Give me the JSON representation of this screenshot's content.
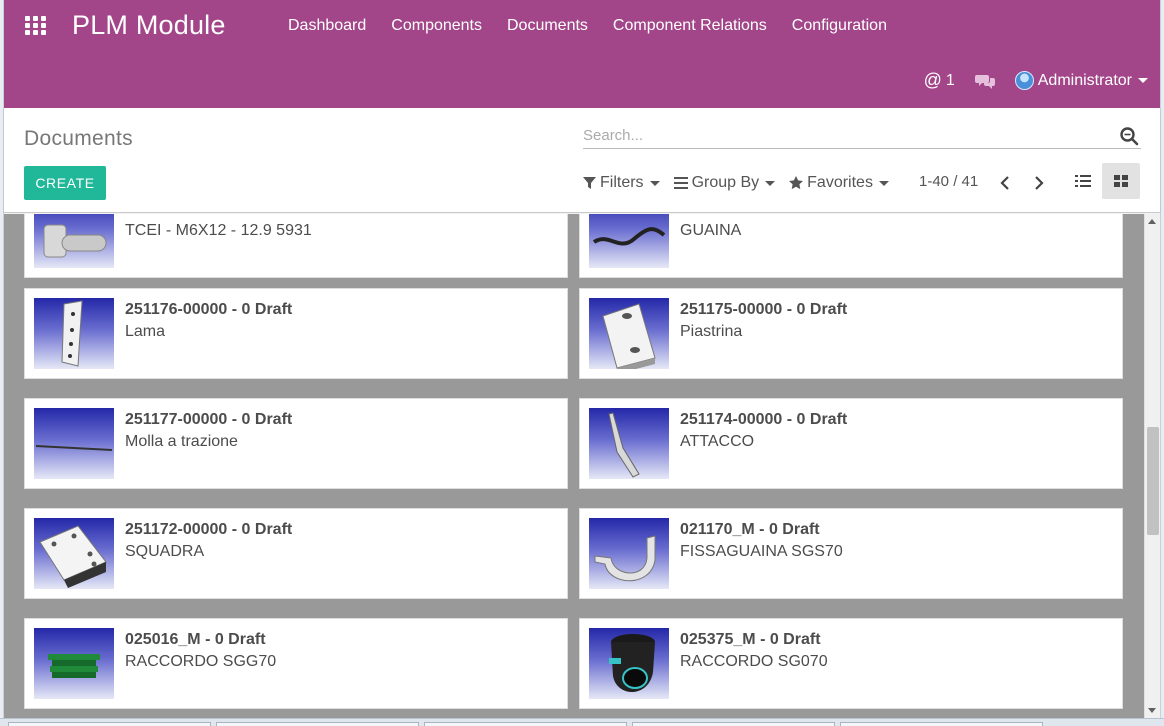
{
  "navbar": {
    "brand": "PLM Module",
    "apps_icon": "apps-grid-icon",
    "menu": [
      {
        "label": "Dashboard"
      },
      {
        "label": "Components"
      },
      {
        "label": "Documents"
      },
      {
        "label": "Component Relations"
      },
      {
        "label": "Configuration"
      }
    ],
    "mentions_count": "1",
    "user": "Administrator",
    "color": "#a24689"
  },
  "control_panel": {
    "breadcrumb": "Documents",
    "create_label": "CREATE",
    "create_color": "#21b799",
    "search_placeholder": "Search...",
    "filters_label": "Filters",
    "group_by_label": "Group By",
    "favorites_label": "Favorites",
    "pager": "1-40 / 41",
    "active_view": "kanban"
  },
  "cards": [
    {
      "title": "",
      "desc": "TCEI - M6X12 - 12.9 5931",
      "icon": "bolt-part-icon"
    },
    {
      "title": "",
      "desc": "GUAINA",
      "icon": "cable-sheath-part-icon"
    },
    {
      "title": "251176-00000 - 0 Draft",
      "desc": "Lama",
      "icon": "blade-part-icon"
    },
    {
      "title": "251175-00000 - 0 Draft",
      "desc": "Piastrina",
      "icon": "plate-part-icon"
    },
    {
      "title": "251177-00000 - 0 Draft",
      "desc": "Molla a trazione",
      "icon": "spring-part-icon"
    },
    {
      "title": "251174-00000 - 0 Draft",
      "desc": "ATTACCO",
      "icon": "bracket-part-icon"
    },
    {
      "title": "251172-00000 - 0 Draft",
      "desc": "SQUADRA",
      "icon": "square-part-icon"
    },
    {
      "title": "021170_M - 0 Draft",
      "desc": "FISSAGUAINA SGS70",
      "icon": "clamp-part-icon"
    },
    {
      "title": "025016_M - 0 Draft",
      "desc": "RACCORDO SGG70",
      "icon": "green-fitting-part-icon"
    },
    {
      "title": "025375_M - 0 Draft",
      "desc": "RACCORDO SG070",
      "icon": "black-fitting-part-icon"
    }
  ]
}
